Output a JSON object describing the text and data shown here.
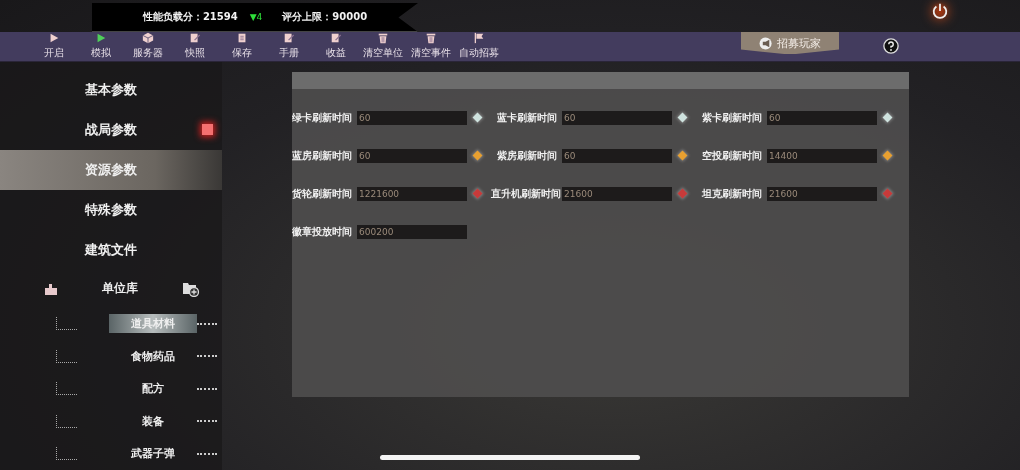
{
  "score_bar": {
    "load_label": "性能负载分：21594",
    "trend": "▼4",
    "limit_label": "评分上限：90000"
  },
  "toolbar": [
    {
      "label": "开启",
      "kind": "play"
    },
    {
      "label": "模拟",
      "kind": "simulate"
    },
    {
      "label": "服务器",
      "kind": "server"
    },
    {
      "label": "快照",
      "kind": "edit"
    },
    {
      "label": "保存",
      "kind": "save"
    },
    {
      "label": "手册",
      "kind": "edit"
    },
    {
      "label": "收益",
      "kind": "edit"
    },
    {
      "label": "清空单位",
      "kind": "trash"
    },
    {
      "label": "清空事件",
      "kind": "trash"
    },
    {
      "label": "自动招募",
      "kind": "flag"
    }
  ],
  "recruit_button": "招募玩家",
  "sidebar": {
    "items": [
      {
        "label": "基本参数",
        "selected": false,
        "alert": false
      },
      {
        "label": "战局参数",
        "selected": false,
        "alert": true
      },
      {
        "label": "资源参数",
        "selected": true,
        "alert": false
      },
      {
        "label": "特殊参数",
        "selected": false,
        "alert": false
      },
      {
        "label": "建筑文件",
        "selected": false,
        "alert": false
      }
    ],
    "unit_library": {
      "label": "单位库",
      "children": [
        {
          "label": "道具材料",
          "selected": true
        },
        {
          "label": "食物药品",
          "selected": false
        },
        {
          "label": "配方",
          "selected": false
        },
        {
          "label": "装备",
          "selected": false
        },
        {
          "label": "武器子弹",
          "selected": false
        }
      ]
    }
  },
  "fields": [
    {
      "label": "绿卡刷新时间",
      "value": "60",
      "color": "#cfe3df"
    },
    {
      "label": "蓝卡刷新时间",
      "value": "60",
      "color": "#cfe3df"
    },
    {
      "label": "紫卡刷新时间",
      "value": "60",
      "color": "#cfe3df"
    },
    {
      "label": "蓝房刷新时间",
      "value": "60",
      "color": "#e8a030"
    },
    {
      "label": "紫房刷新时间",
      "value": "60",
      "color": "#e8a030"
    },
    {
      "label": "空投刷新时间",
      "value": "14400",
      "color": "#e8a030"
    },
    {
      "label": "货轮刷新时间",
      "value": "1221600",
      "color": "#c83a3a"
    },
    {
      "label": "直升机刷新时间",
      "value": "21600",
      "color": "#c83a3a"
    },
    {
      "label": "坦克刷新时间",
      "value": "21600",
      "color": "#c83a3a"
    },
    {
      "label": "徽章投放时间",
      "value": "600200"
    }
  ]
}
